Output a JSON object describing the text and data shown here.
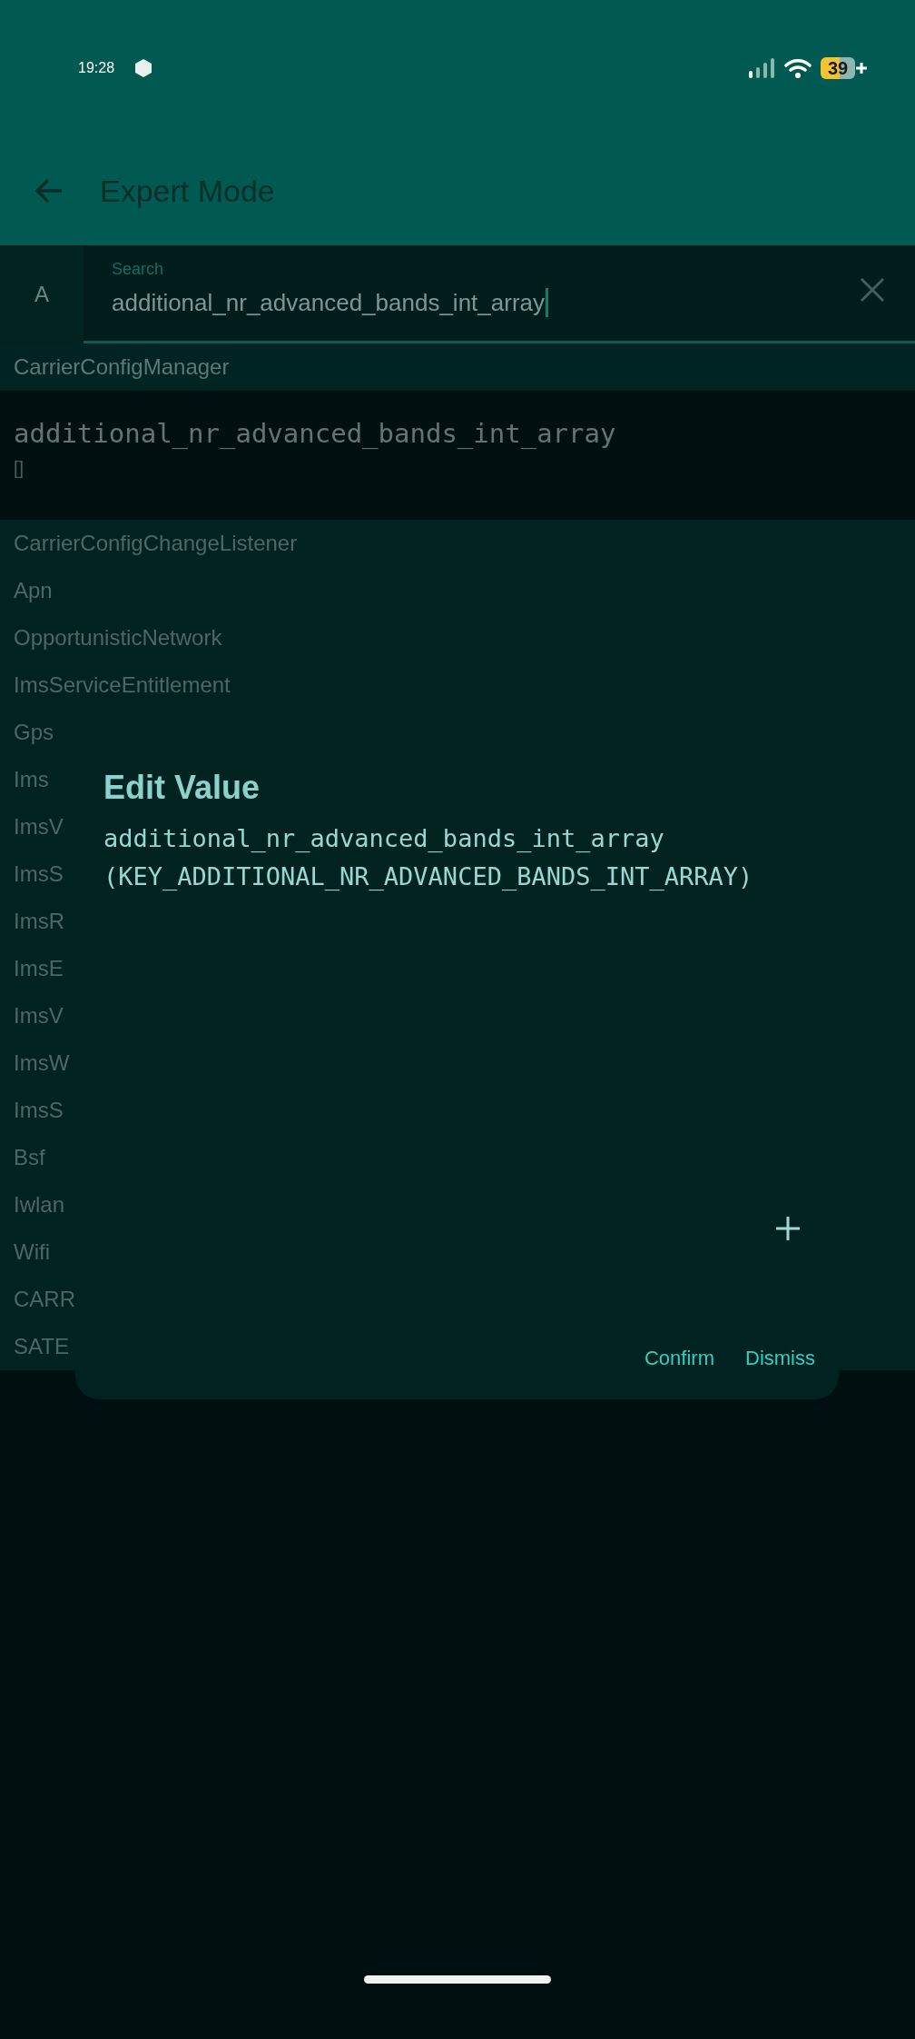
{
  "status_bar": {
    "time": "19:28",
    "battery": "39"
  },
  "app_bar": {
    "title": "Expert Mode"
  },
  "search": {
    "tab": "A",
    "label": "Search",
    "value": "additional_nr_advanced_bands_int_array"
  },
  "section": {
    "title": "CarrierConfigManager",
    "results": [
      {
        "key": "additional_nr_advanced_bands_int_array",
        "value": "[]"
      }
    ]
  },
  "categories": [
    "CarrierConfigChangeListener",
    "Apn",
    "OpportunisticNetwork",
    "ImsServiceEntitlement",
    "Gps",
    "Ims",
    "ImsV",
    "ImsS",
    "ImsR",
    "ImsE",
    "ImsV",
    "ImsW",
    "ImsS",
    "Bsf",
    "Iwlan",
    "Wifi",
    "CARR",
    "SATE"
  ],
  "dialog": {
    "title": "Edit Value",
    "key": "additional_nr_advanced_bands_int_array",
    "constant": "(KEY_ADDITIONAL_NR_ADVANCED_BANDS_INT_ARRAY)",
    "buttons": [
      "Confirm",
      "Dismiss"
    ]
  }
}
